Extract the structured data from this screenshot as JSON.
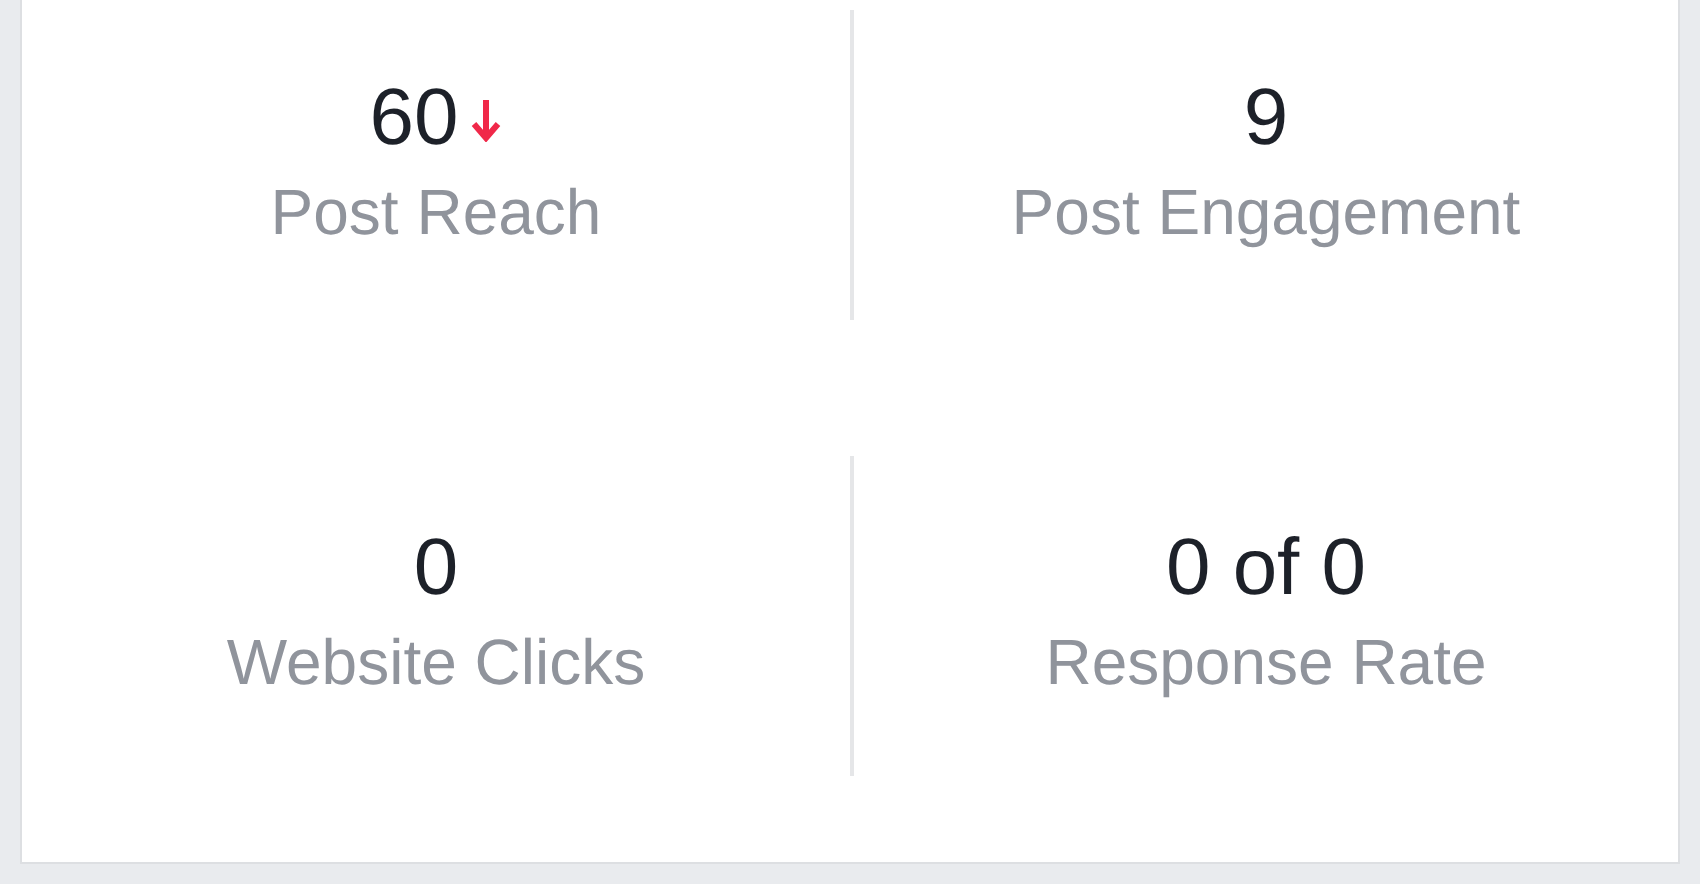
{
  "metrics": [
    {
      "value": "60",
      "label": "Post Reach",
      "trending_down": true
    },
    {
      "value": "9",
      "label": "Post Engagement",
      "trending_down": false
    },
    {
      "value": "0",
      "label": "Website Clicks",
      "trending_down": false
    },
    {
      "value": "0 of 0",
      "label": "Response Rate",
      "trending_down": false
    }
  ]
}
